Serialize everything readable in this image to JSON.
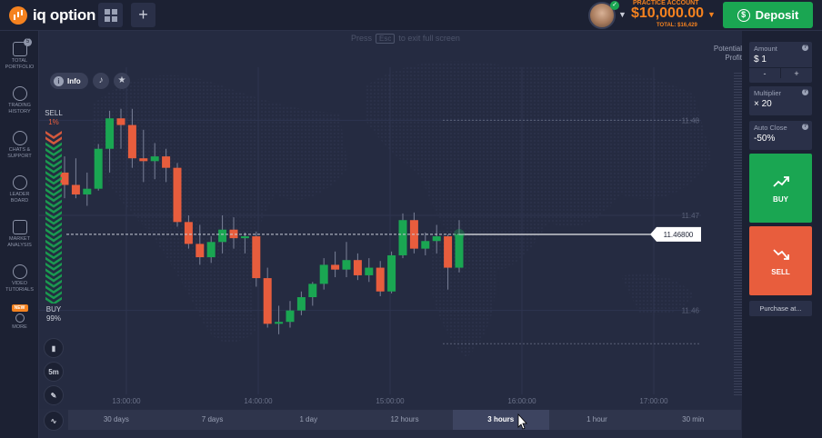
{
  "app": {
    "logo_text": "iq option"
  },
  "header": {
    "account_label": "PRACTICE ACCOUNT",
    "balance": "$10,000.00",
    "total": "TOTAL: $16,429",
    "deposit_label": "Deposit"
  },
  "sidebar": {
    "items": [
      {
        "label": "TOTAL PORTFOLIO",
        "icon": "briefcase-icon",
        "badge": "5"
      },
      {
        "label": "TRADING HISTORY",
        "icon": "history-icon"
      },
      {
        "label": "CHATS & SUPPORT",
        "icon": "chat-icon"
      },
      {
        "label": "LEADER BOARD",
        "icon": "leaderboard-icon"
      },
      {
        "label": "MARKET ANALYSIS",
        "icon": "analysis-icon"
      },
      {
        "label": "VIDEO TUTORIALS",
        "icon": "play-icon"
      },
      {
        "label": "MORE",
        "icon": "more-icon",
        "badge": "NEW"
      }
    ]
  },
  "chart": {
    "fullscreen_hint_pre": "Press",
    "fullscreen_hint_key": "Esc",
    "fullscreen_hint_post": "to exit full screen",
    "potential_profit": "Potential Profit",
    "info_label": "Info",
    "sell_label": "SELL",
    "sell_pct": "1%",
    "buy_label": "BUY",
    "buy_pct": "99%",
    "timeframe_btn": "5m",
    "current_price": "11.46800"
  },
  "chart_data": {
    "type": "candlestick",
    "x_ticks": [
      "13:00:00",
      "14:00:00",
      "15:00:00",
      "16:00:00",
      "17:00:00"
    ],
    "y_ticks": [
      "11.48",
      "11.47",
      "11.46"
    ],
    "current_price": 11.468,
    "candles": [
      {
        "o": 11.4745,
        "h": 11.4762,
        "l": 11.4718,
        "c": 11.4732
      },
      {
        "o": 11.4732,
        "h": 11.476,
        "l": 11.4718,
        "c": 11.4722
      },
      {
        "o": 11.4722,
        "h": 11.4745,
        "l": 11.471,
        "c": 11.4728
      },
      {
        "o": 11.4728,
        "h": 11.4775,
        "l": 11.4726,
        "c": 11.477
      },
      {
        "o": 11.477,
        "h": 11.481,
        "l": 11.4745,
        "c": 11.4802
      },
      {
        "o": 11.4802,
        "h": 11.4812,
        "l": 11.477,
        "c": 11.4795
      },
      {
        "o": 11.4795,
        "h": 11.4812,
        "l": 11.475,
        "c": 11.476
      },
      {
        "o": 11.476,
        "h": 11.479,
        "l": 11.4735,
        "c": 11.4757
      },
      {
        "o": 11.4757,
        "h": 11.4776,
        "l": 11.4738,
        "c": 11.4762
      },
      {
        "o": 11.4762,
        "h": 11.477,
        "l": 11.4735,
        "c": 11.475
      },
      {
        "o": 11.475,
        "h": 11.4755,
        "l": 11.4688,
        "c": 11.4693
      },
      {
        "o": 11.4693,
        "h": 11.47,
        "l": 11.4665,
        "c": 11.467
      },
      {
        "o": 11.467,
        "h": 11.469,
        "l": 11.4648,
        "c": 11.4656
      },
      {
        "o": 11.4656,
        "h": 11.4678,
        "l": 11.465,
        "c": 11.4672
      },
      {
        "o": 11.4672,
        "h": 11.47,
        "l": 11.466,
        "c": 11.4685
      },
      {
        "o": 11.4685,
        "h": 11.4698,
        "l": 11.4665,
        "c": 11.4676
      },
      {
        "o": 11.4676,
        "h": 11.4682,
        "l": 11.466,
        "c": 11.4678
      },
      {
        "o": 11.4678,
        "h": 11.4683,
        "l": 11.4625,
        "c": 11.4634
      },
      {
        "o": 11.4634,
        "h": 11.4645,
        "l": 11.4582,
        "c": 11.4586
      },
      {
        "o": 11.4586,
        "h": 11.4605,
        "l": 11.4575,
        "c": 11.4588
      },
      {
        "o": 11.4588,
        "h": 11.461,
        "l": 11.4582,
        "c": 11.46
      },
      {
        "o": 11.46,
        "h": 11.462,
        "l": 11.4595,
        "c": 11.4614
      },
      {
        "o": 11.4614,
        "h": 11.463,
        "l": 11.4605,
        "c": 11.4628
      },
      {
        "o": 11.4628,
        "h": 11.4655,
        "l": 11.4622,
        "c": 11.4648
      },
      {
        "o": 11.4648,
        "h": 11.4662,
        "l": 11.4635,
        "c": 11.4643
      },
      {
        "o": 11.4643,
        "h": 11.4672,
        "l": 11.4635,
        "c": 11.4653
      },
      {
        "o": 11.4653,
        "h": 11.466,
        "l": 11.4632,
        "c": 11.4637
      },
      {
        "o": 11.4637,
        "h": 11.4655,
        "l": 11.463,
        "c": 11.4645
      },
      {
        "o": 11.4645,
        "h": 11.4652,
        "l": 11.4615,
        "c": 11.462
      },
      {
        "o": 11.462,
        "h": 11.4662,
        "l": 11.4618,
        "c": 11.4658
      },
      {
        "o": 11.4658,
        "h": 11.4702,
        "l": 11.4655,
        "c": 11.4695
      },
      {
        "o": 11.4695,
        "h": 11.4703,
        "l": 11.466,
        "c": 11.4665
      },
      {
        "o": 11.4665,
        "h": 11.4682,
        "l": 11.4658,
        "c": 11.4673
      },
      {
        "o": 11.4673,
        "h": 11.469,
        "l": 11.466,
        "c": 11.4678
      },
      {
        "o": 11.4678,
        "h": 11.468,
        "l": 11.4622,
        "c": 11.4645
      },
      {
        "o": 11.4645,
        "h": 11.4695,
        "l": 11.464,
        "c": 11.468
      }
    ],
    "grid": true,
    "background": "world-map"
  },
  "timeframes": [
    "30 days",
    "7 days",
    "1 day",
    "12 hours",
    "3 hours",
    "1 hour",
    "30 min"
  ],
  "active_timeframe": "3 hours",
  "right_panel": {
    "amount_label": "Amount",
    "amount_value": "$ 1",
    "minus": "-",
    "plus": "+",
    "multiplier_label": "Multiplier",
    "multiplier_value": "× 20",
    "auto_close_label": "Auto Close",
    "auto_close_value": "-50%",
    "buy_label": "BUY",
    "sell_label": "SELL",
    "purchase_label": "Purchase at..."
  },
  "colors": {
    "up": "#1aa652",
    "down": "#e85d3d",
    "accent": "#f5821f"
  }
}
